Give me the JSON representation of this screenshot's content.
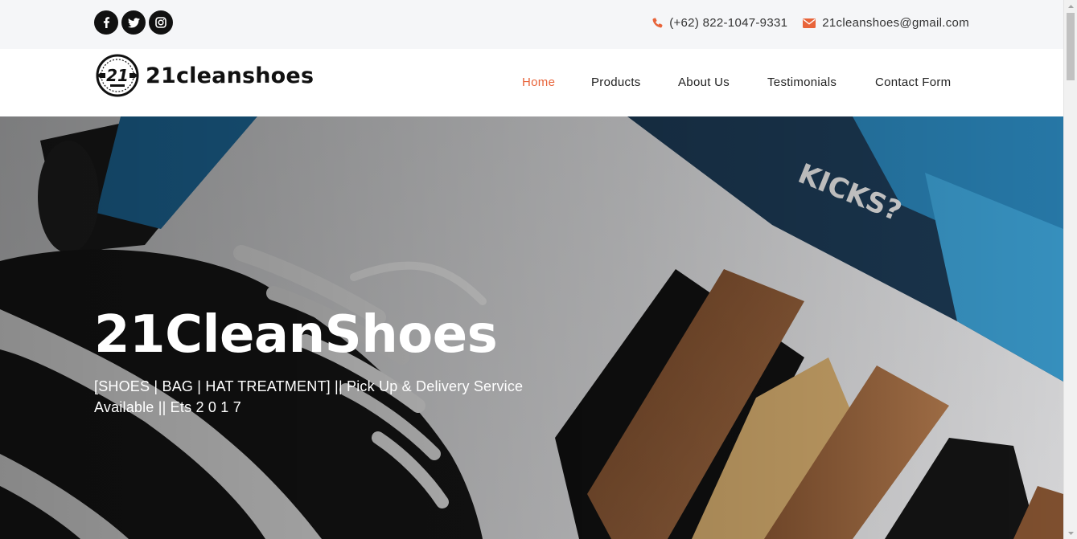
{
  "topbar": {
    "social": [
      {
        "name": "facebook-icon"
      },
      {
        "name": "twitter-icon"
      },
      {
        "name": "instagram-icon"
      }
    ],
    "phone": "(+62) 822-1047-9331",
    "email": "21cleanshoes@gmail.com",
    "accent_color": "#e8643a"
  },
  "header": {
    "logo_text": "21cleanshoes",
    "logo_mark_text": "21",
    "nav": [
      {
        "label": "Home",
        "active": true
      },
      {
        "label": "Products",
        "active": false
      },
      {
        "label": "About Us",
        "active": false
      },
      {
        "label": "Testimonials",
        "active": false
      },
      {
        "label": "Contact Form",
        "active": false
      }
    ]
  },
  "hero": {
    "title": "21CleanShoes",
    "subtitle": "[SHOES | BAG | HAT TREATMENT] || Pick Up & Delivery Service Available || Ets 2 0 1 7",
    "background_image": "sneaker-cleaning-kit-photo"
  }
}
